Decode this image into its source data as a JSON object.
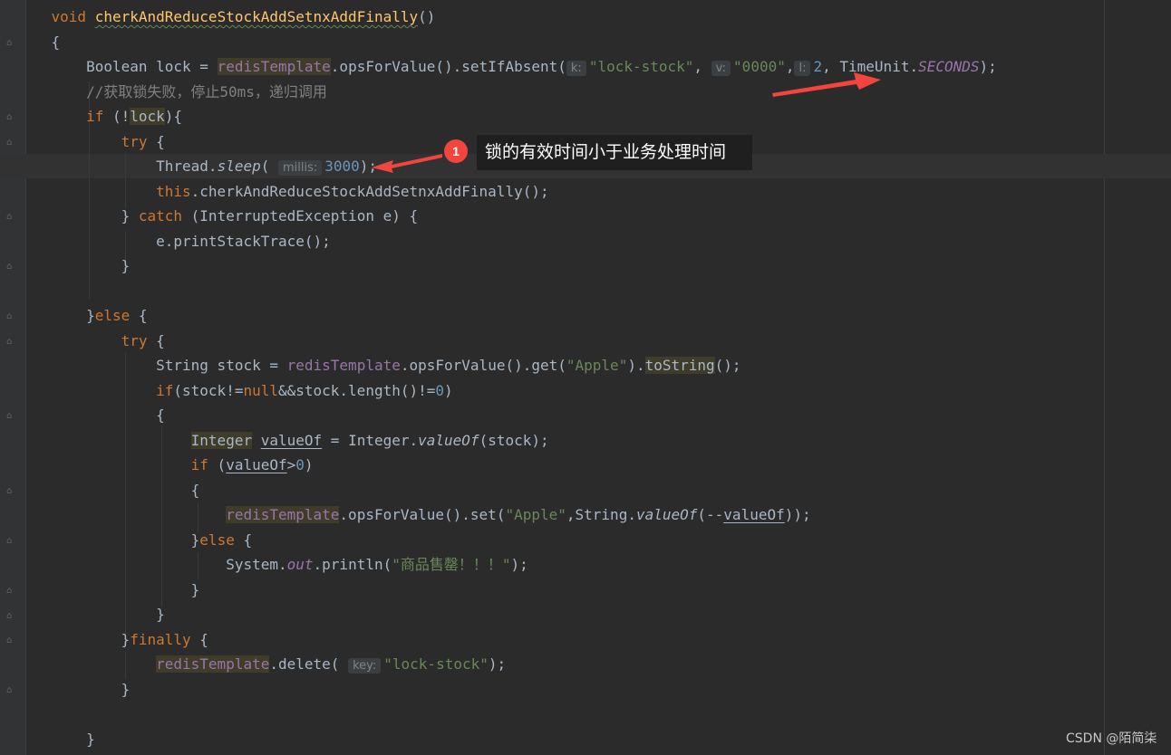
{
  "method_name": "cherkAndReduceStockAddSetnxAddFinally",
  "hints": {
    "k": "k:",
    "v": "v:",
    "l": "l:",
    "millis": "millis:",
    "key": "key:"
  },
  "annotation": {
    "number": "1",
    "text": "锁的有效时间小于业务处理时间"
  },
  "watermark": "CSDN @陌简柒",
  "strings": {
    "lock_key": "\"lock-stock\"",
    "lock_val": "\"0000\"",
    "apple": "\"Apple\"",
    "sold_out": "\"商品售罄！！！\"",
    "comment": "//获取锁失败，停止50ms，递归调用"
  },
  "numbers": {
    "timeout": "2",
    "sleep": "3000",
    "zero": "0"
  },
  "colors": {
    "background": "#2b2b2b",
    "keyword": "#cc7832",
    "string": "#6a8759",
    "number": "#6897bb",
    "field": "#9876aa",
    "method": "#ffc66d",
    "arrow": "#f2453d"
  }
}
